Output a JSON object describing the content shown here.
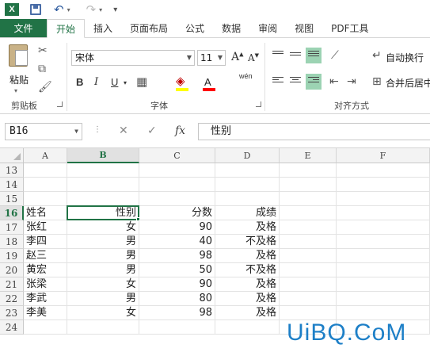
{
  "app": {
    "logo": "X"
  },
  "ribbon_tabs": [
    "文件",
    "开始",
    "插入",
    "页面布局",
    "公式",
    "数据",
    "审阅",
    "视图",
    "PDF工具"
  ],
  "clipboard": {
    "paste_label": "粘贴",
    "group_label": "剪贴板"
  },
  "font": {
    "family": "宋体",
    "size": "11",
    "group_label": "字体",
    "bold": "B",
    "italic": "I",
    "underline": "U",
    "phonetic": "wén"
  },
  "alignment": {
    "wrap_label": "自动换行",
    "merge_label": "合并后居中",
    "group_label": "对齐方式"
  },
  "formula_bar": {
    "name_box": "B16",
    "fx": "fx",
    "content": "性别"
  },
  "columns": [
    "A",
    "B",
    "C",
    "D",
    "E",
    "F"
  ],
  "selected_column": "B",
  "rows": [
    {
      "n": "13",
      "cells": [
        "",
        "",
        "",
        ""
      ]
    },
    {
      "n": "14",
      "cells": [
        "",
        "",
        "",
        ""
      ]
    },
    {
      "n": "15",
      "cells": [
        "",
        "",
        "",
        ""
      ]
    },
    {
      "n": "16",
      "cells": [
        "姓名",
        "性别",
        "分数",
        "成绩"
      ]
    },
    {
      "n": "17",
      "cells": [
        "张红",
        "女",
        "90",
        "及格"
      ]
    },
    {
      "n": "18",
      "cells": [
        "李四",
        "男",
        "40",
        "不及格"
      ]
    },
    {
      "n": "19",
      "cells": [
        "赵三",
        "男",
        "98",
        "及格"
      ]
    },
    {
      "n": "20",
      "cells": [
        "黄宏",
        "男",
        "50",
        "不及格"
      ]
    },
    {
      "n": "21",
      "cells": [
        "张梁",
        "女",
        "90",
        "及格"
      ]
    },
    {
      "n": "22",
      "cells": [
        "李武",
        "男",
        "80",
        "及格"
      ]
    },
    {
      "n": "23",
      "cells": [
        "李美",
        "女",
        "98",
        "及格"
      ]
    },
    {
      "n": "24",
      "cells": [
        "",
        "",
        "",
        ""
      ]
    }
  ],
  "selected_row": "16",
  "watermark": "UiBQ.CoM",
  "colors": {
    "excel_green": "#217346",
    "align_selected": "#9cd3b3",
    "watermark": "#1d7fc7"
  }
}
